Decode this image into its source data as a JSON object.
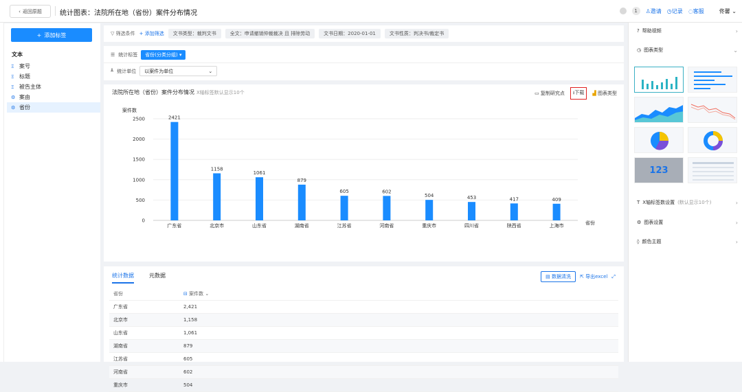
{
  "topbar": {
    "back_label": "返回原题",
    "title": "统计图表：法院所在地（省份）案件分布情况",
    "notif_count": "1",
    "invite_label": "邀请",
    "record_label": "记录",
    "service_label": "客服",
    "user_name": "佟馨"
  },
  "sidebar": {
    "add_label": "添加标签",
    "section_heading": "文本",
    "items": [
      {
        "label": "案号",
        "icon": "text-icon"
      },
      {
        "label": "标题",
        "icon": "text-icon"
      },
      {
        "label": "被告主体",
        "icon": "text-icon"
      },
      {
        "label": "案由",
        "icon": "tree-icon"
      },
      {
        "label": "省份",
        "icon": "tree-icon"
      }
    ]
  },
  "filters": {
    "label": "筛选条件",
    "add_label": "+ 添加筛选",
    "chips": [
      "文书类型：裁判文书",
      "全文：申请撤销仲裁裁决 且 排除劳动",
      "文书日期：2020-01-01",
      "文书性质：判决书/裁定书"
    ]
  },
  "stats": {
    "tag_label": "统计标签",
    "tag_value": "省份(分类分组) ▾",
    "unit_label": "统计单位",
    "unit_value": "以案件为单位"
  },
  "chart_header": {
    "title": "法院所在地（省份）案件分布情况",
    "hint": "X轴标签默认显示10个",
    "copy_label": "复制研究点",
    "download_label": "下载",
    "type_label": "图表类型"
  },
  "chart_data": {
    "type": "bar",
    "categories": [
      "广东省",
      "北京市",
      "山东省",
      "湖南省",
      "江苏省",
      "河南省",
      "重庆市",
      "四川省",
      "陕西省",
      "上海市"
    ],
    "values": [
      2421,
      1158,
      1061,
      879,
      605,
      602,
      504,
      453,
      417,
      409
    ],
    "ylabel": "案件数",
    "xlabel": "省份",
    "ylim": [
      0,
      2500
    ],
    "yticks": [
      0,
      500,
      1000,
      1500,
      2000,
      2500
    ],
    "bar_color": "#1a8cff",
    "grid": true
  },
  "table": {
    "tab_active": "统计数据",
    "tab_other": "元数据",
    "clean_label": "数据清洗",
    "export_label": "导出excel",
    "col1": "省份",
    "col2": "案件数",
    "rows": [
      {
        "name": "广东省",
        "value": "2,421"
      },
      {
        "name": "北京市",
        "value": "1,158"
      },
      {
        "name": "山东省",
        "value": "1,061"
      },
      {
        "name": "湖南省",
        "value": "879"
      },
      {
        "name": "江苏省",
        "value": "605"
      },
      {
        "name": "河南省",
        "value": "602"
      },
      {
        "name": "重庆市",
        "value": "504"
      }
    ]
  },
  "right_panel": {
    "help_video": "帮助视频",
    "chart_types": "图表类型",
    "thumb_number": "123",
    "xaxis_setting": "X轴标签数设置",
    "xaxis_hint": "(默认显示10个)",
    "chart_setting": "图表设置",
    "color_theme": "颜色主题"
  }
}
